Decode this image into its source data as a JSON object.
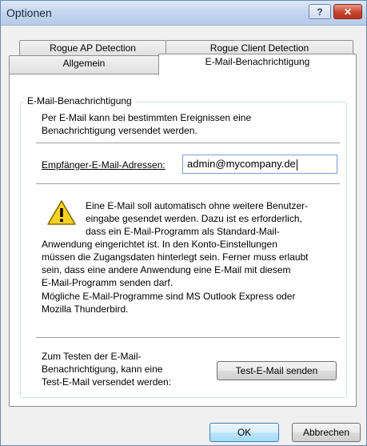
{
  "window": {
    "title": "Optionen",
    "help_label": "?",
    "close_label": "✕"
  },
  "tabs": [
    {
      "label": "Rogue AP Detection"
    },
    {
      "label": "Rogue Client Detection"
    },
    {
      "label": "Allgemein"
    },
    {
      "label": "E-Mail-Benachrichtigung",
      "active": true
    }
  ],
  "group": {
    "legend": "E-Mail-Benachrichtigung",
    "intro_line1": "Per E-Mail kann bei bestimmten Ereignissen eine",
    "intro_line2": "Benachrichtigung versendet werden.",
    "recipients_label": "Empfänger-E-Mail-Adressen:",
    "recipients_value": "admin@mycompany.de",
    "warning_lines": [
      "Eine E-Mail soll automatisch ohne weitere Benutzer-",
      "eingabe gesendet werden. Dazu ist es erforderlich,",
      "dass ein E-Mail-Programm als Standard-Mail-",
      "Anwendung eingerichtet ist. In den Konto-Einstellungen",
      "müssen die Zugangsdaten hinterlegt sein. Ferner muss erlaubt",
      "sein, dass eine andere Anwendung eine E-Mail mit diesem",
      "E-Mail-Programm senden darf."
    ],
    "programs_line1": "Mögliche E-Mail-Programme sind MS Outlook Express oder",
    "programs_line2": "Mozilla Thunderbird.",
    "test_line1": "Zum Testen der E-Mail-",
    "test_line2": "Benachrichtigung, kann eine",
    "test_line3": "Test-E-Mail versendet werden:",
    "test_button": "Test-E-Mail senden"
  },
  "footer": {
    "ok_label": "OK",
    "cancel_label": "Abbrechen"
  },
  "icons": {
    "warning": "warning-icon"
  },
  "colors": {
    "titlebar": "#c4d6ee",
    "close": "#c6452f",
    "default_button": "#bee6fd"
  }
}
